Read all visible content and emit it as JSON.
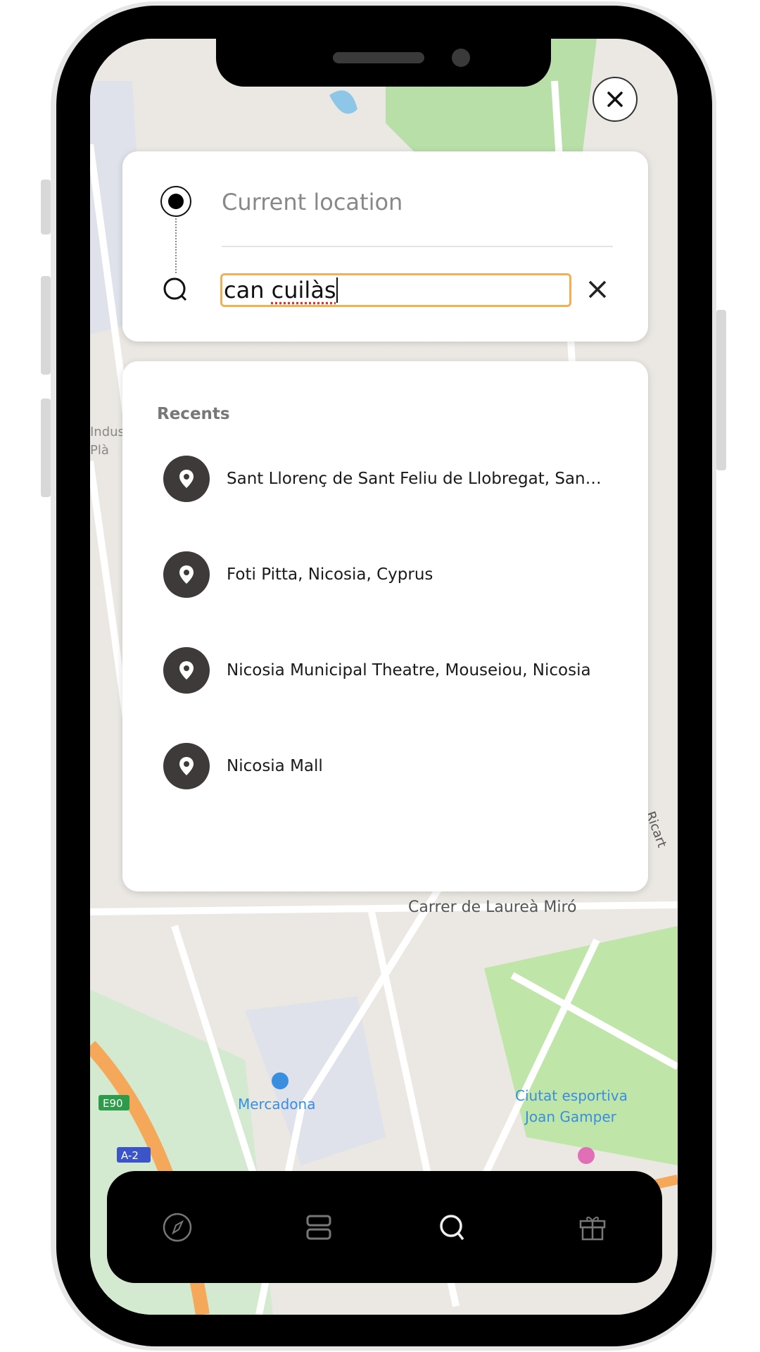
{
  "search": {
    "origin_label": "Current location",
    "query": "can cuilàs",
    "query_prefix": "can ",
    "query_misspelled": "cuilàs"
  },
  "recents": {
    "title": "Recents",
    "items": [
      {
        "label": "Sant Llorenç de Sant Feliu de Llobregat, Sant Feliu de Llobregat",
        "icon": "location-pin-icon"
      },
      {
        "label": "Foti Pitta, Nicosia, Cyprus",
        "icon": "location-pin-icon"
      },
      {
        "label": "Nicosia Municipal Theatre, Mouseiou, Nicosia",
        "icon": "location-pin-icon"
      },
      {
        "label": "Nicosia Mall",
        "icon": "location-pin-icon"
      }
    ]
  },
  "map": {
    "labels": [
      "Mercadona",
      "Ciutat esportiva",
      "Joan Gamper",
      "Carrer de Laureà Miró",
      "E90",
      "A-2",
      "Indus",
      "Plà",
      "Ricart"
    ]
  },
  "nav": {
    "items": [
      {
        "icon": "compass-icon",
        "active": false
      },
      {
        "icon": "list-icon",
        "active": false
      },
      {
        "icon": "search-icon",
        "active": true
      },
      {
        "icon": "gift-icon",
        "active": false
      }
    ]
  },
  "colors": {
    "input_focus": "#f2b056",
    "pin_bg": "#3f3a3a",
    "nav_bg": "#000000"
  }
}
